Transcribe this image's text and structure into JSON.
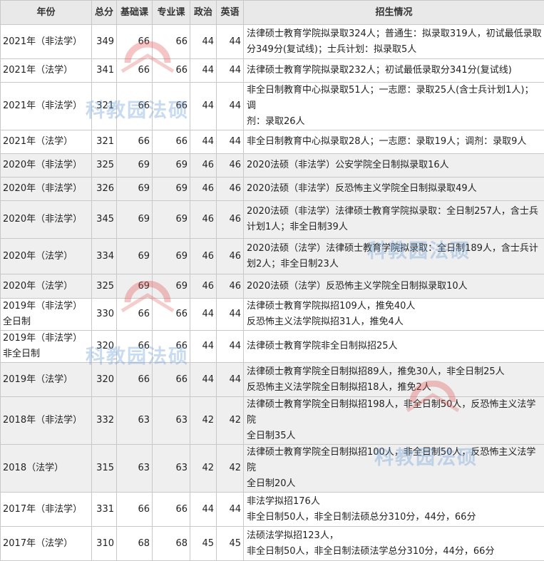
{
  "headers": [
    "年份",
    "总分",
    "基础课",
    "专业课",
    "政治",
    "英语",
    "招生情况"
  ],
  "rows": [
    {
      "year": "2021年（非法学）",
      "total": "349",
      "basic": "66",
      "major": "66",
      "politics": "44",
      "english": "44",
      "info": [
        "法律硕士教育学院拟录取324人；普通生：拟录取319人，初试最低录取",
        "分349分(复试线)；士兵计划：拟录取5人"
      ]
    },
    {
      "year": "2021年（法学）",
      "total": "341",
      "basic": "66",
      "major": "66",
      "politics": "44",
      "english": "44",
      "info": [
        "法律硕士教育学院拟录取232人；初试最低录取分341分(复试线)"
      ]
    },
    {
      "year": "2021年（非法学）",
      "total": "321",
      "basic": "66",
      "major": "66",
      "politics": "44",
      "english": "44",
      "info": [
        "非全日制教育中心拟录取51人；一志愿：录取25人(含士兵计划1人)；调",
        "剂：录取26人"
      ]
    },
    {
      "year": "2021年（法学）",
      "total": "321",
      "basic": "66",
      "major": "66",
      "politics": "44",
      "english": "44",
      "info": [
        "非全日制教育中心拟录取28人；一志愿：录取19人；调剂：录取9人"
      ]
    },
    {
      "year": "2020年（非法学）",
      "total": "325",
      "basic": "69",
      "major": "69",
      "politics": "46",
      "english": "46",
      "info": [
        "2020法硕（非法学）公安学院全日制拟录取16人"
      ]
    },
    {
      "year": "2020年（非法学）",
      "total": "326",
      "basic": "69",
      "major": "69",
      "politics": "46",
      "english": "46",
      "info": [
        "2020法硕（非法学）反恐怖主义学院全日制拟录取49人"
      ]
    },
    {
      "year": "2020年（非法学）",
      "total": "345",
      "basic": "69",
      "major": "69",
      "politics": "46",
      "english": "46",
      "info": [
        "2020法硕（非法学）法律硕士教育学院拟录取：全日制257人，含士兵",
        "计划1人；非全日制39人"
      ]
    },
    {
      "year": "2020年（法学）",
      "total": "334",
      "basic": "69",
      "major": "69",
      "politics": "46",
      "english": "46",
      "info": [
        "2020法硕（法学）法律硕士教育学院拟录取：全日制189人，含士兵计",
        "划2人；非全日制23人"
      ]
    },
    {
      "year": "2020年（法学）",
      "total": "325",
      "basic": "69",
      "major": "69",
      "politics": "46",
      "english": "46",
      "info": [
        "2020法硕（法学）反恐怖主义学院全日制拟录取10人"
      ]
    },
    {
      "year": "2019年（非法学）全日制",
      "total": "330",
      "basic": "66",
      "major": "66",
      "politics": "44",
      "english": "44",
      "info": [
        "法律硕士教育学院拟招109人，推免40人",
        "反恐怖主义法学院拟招31人，推免4人"
      ]
    },
    {
      "year": "2019年（非法学）非全日制",
      "total": "320",
      "basic": "66",
      "major": "66",
      "politics": "44",
      "english": "44",
      "info": [
        "法律硕士教育学院非全日制拟招25人"
      ]
    },
    {
      "year": "2019年（法学）",
      "total": "320",
      "basic": "66",
      "major": "66",
      "politics": "44",
      "english": "44",
      "info": [
        "法律硕士教育学院全日制拟招89人，推免30人，非全日制25人",
        "反恐怖主义法学院全日制拟招18人，推免2人"
      ]
    },
    {
      "year": "2018年（非法学）",
      "total": "332",
      "basic": "63",
      "major": "63",
      "politics": "42",
      "english": "42",
      "info": [
        "法律硕士教育学院全日制拟招198人，非全日制50人，反恐怖主义法学院",
        "全日制35人"
      ]
    },
    {
      "year": "2018（法学）",
      "total": "315",
      "basic": "63",
      "major": "63",
      "politics": "42",
      "english": "42",
      "info": [
        "法律硕士教育学院全日制拟招100人，非全日制50人，反恐怖主义法学院",
        "全日制20人"
      ]
    },
    {
      "year": "2017年（非法学）",
      "total": "331",
      "basic": "66",
      "major": "66",
      "politics": "44",
      "english": "44",
      "info": [
        "非法学拟招176人",
        "非全日制50人，非全日制法硕总分310分，44分，66分"
      ]
    },
    {
      "year": "2017年（法学）",
      "total": "310",
      "basic": "68",
      "major": "68",
      "politics": "45",
      "english": "45",
      "info": [
        "法硕法学拟招123人，",
        "非全日制50人，非全日制法硕法学总分310分，44分，66分"
      ]
    }
  ],
  "watermark": {
    "text": "科教园法硕",
    "logo_text": "KJY",
    "logo_color": "#e25a5a",
    "text_color": "#7aa6d8"
  }
}
